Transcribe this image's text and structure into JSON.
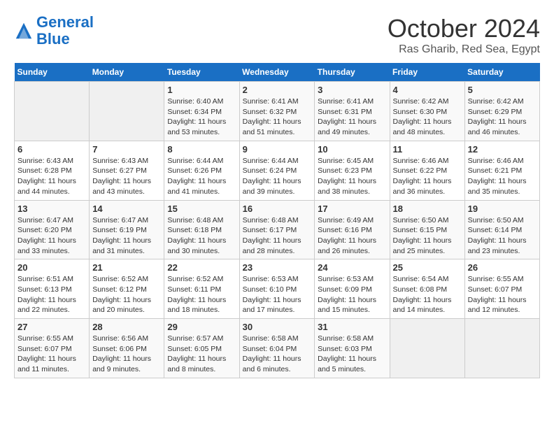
{
  "header": {
    "logo_line1": "General",
    "logo_line2": "Blue",
    "month": "October 2024",
    "location": "Ras Gharib, Red Sea, Egypt"
  },
  "weekdays": [
    "Sunday",
    "Monday",
    "Tuesday",
    "Wednesday",
    "Thursday",
    "Friday",
    "Saturday"
  ],
  "weeks": [
    [
      {
        "day": "",
        "info": ""
      },
      {
        "day": "",
        "info": ""
      },
      {
        "day": "1",
        "info": "Sunrise: 6:40 AM\nSunset: 6:34 PM\nDaylight: 11 hours and 53 minutes."
      },
      {
        "day": "2",
        "info": "Sunrise: 6:41 AM\nSunset: 6:32 PM\nDaylight: 11 hours and 51 minutes."
      },
      {
        "day": "3",
        "info": "Sunrise: 6:41 AM\nSunset: 6:31 PM\nDaylight: 11 hours and 49 minutes."
      },
      {
        "day": "4",
        "info": "Sunrise: 6:42 AM\nSunset: 6:30 PM\nDaylight: 11 hours and 48 minutes."
      },
      {
        "day": "5",
        "info": "Sunrise: 6:42 AM\nSunset: 6:29 PM\nDaylight: 11 hours and 46 minutes."
      }
    ],
    [
      {
        "day": "6",
        "info": "Sunrise: 6:43 AM\nSunset: 6:28 PM\nDaylight: 11 hours and 44 minutes."
      },
      {
        "day": "7",
        "info": "Sunrise: 6:43 AM\nSunset: 6:27 PM\nDaylight: 11 hours and 43 minutes."
      },
      {
        "day": "8",
        "info": "Sunrise: 6:44 AM\nSunset: 6:26 PM\nDaylight: 11 hours and 41 minutes."
      },
      {
        "day": "9",
        "info": "Sunrise: 6:44 AM\nSunset: 6:24 PM\nDaylight: 11 hours and 39 minutes."
      },
      {
        "day": "10",
        "info": "Sunrise: 6:45 AM\nSunset: 6:23 PM\nDaylight: 11 hours and 38 minutes."
      },
      {
        "day": "11",
        "info": "Sunrise: 6:46 AM\nSunset: 6:22 PM\nDaylight: 11 hours and 36 minutes."
      },
      {
        "day": "12",
        "info": "Sunrise: 6:46 AM\nSunset: 6:21 PM\nDaylight: 11 hours and 35 minutes."
      }
    ],
    [
      {
        "day": "13",
        "info": "Sunrise: 6:47 AM\nSunset: 6:20 PM\nDaylight: 11 hours and 33 minutes."
      },
      {
        "day": "14",
        "info": "Sunrise: 6:47 AM\nSunset: 6:19 PM\nDaylight: 11 hours and 31 minutes."
      },
      {
        "day": "15",
        "info": "Sunrise: 6:48 AM\nSunset: 6:18 PM\nDaylight: 11 hours and 30 minutes."
      },
      {
        "day": "16",
        "info": "Sunrise: 6:48 AM\nSunset: 6:17 PM\nDaylight: 11 hours and 28 minutes."
      },
      {
        "day": "17",
        "info": "Sunrise: 6:49 AM\nSunset: 6:16 PM\nDaylight: 11 hours and 26 minutes."
      },
      {
        "day": "18",
        "info": "Sunrise: 6:50 AM\nSunset: 6:15 PM\nDaylight: 11 hours and 25 minutes."
      },
      {
        "day": "19",
        "info": "Sunrise: 6:50 AM\nSunset: 6:14 PM\nDaylight: 11 hours and 23 minutes."
      }
    ],
    [
      {
        "day": "20",
        "info": "Sunrise: 6:51 AM\nSunset: 6:13 PM\nDaylight: 11 hours and 22 minutes."
      },
      {
        "day": "21",
        "info": "Sunrise: 6:52 AM\nSunset: 6:12 PM\nDaylight: 11 hours and 20 minutes."
      },
      {
        "day": "22",
        "info": "Sunrise: 6:52 AM\nSunset: 6:11 PM\nDaylight: 11 hours and 18 minutes."
      },
      {
        "day": "23",
        "info": "Sunrise: 6:53 AM\nSunset: 6:10 PM\nDaylight: 11 hours and 17 minutes."
      },
      {
        "day": "24",
        "info": "Sunrise: 6:53 AM\nSunset: 6:09 PM\nDaylight: 11 hours and 15 minutes."
      },
      {
        "day": "25",
        "info": "Sunrise: 6:54 AM\nSunset: 6:08 PM\nDaylight: 11 hours and 14 minutes."
      },
      {
        "day": "26",
        "info": "Sunrise: 6:55 AM\nSunset: 6:07 PM\nDaylight: 11 hours and 12 minutes."
      }
    ],
    [
      {
        "day": "27",
        "info": "Sunrise: 6:55 AM\nSunset: 6:07 PM\nDaylight: 11 hours and 11 minutes."
      },
      {
        "day": "28",
        "info": "Sunrise: 6:56 AM\nSunset: 6:06 PM\nDaylight: 11 hours and 9 minutes."
      },
      {
        "day": "29",
        "info": "Sunrise: 6:57 AM\nSunset: 6:05 PM\nDaylight: 11 hours and 8 minutes."
      },
      {
        "day": "30",
        "info": "Sunrise: 6:58 AM\nSunset: 6:04 PM\nDaylight: 11 hours and 6 minutes."
      },
      {
        "day": "31",
        "info": "Sunrise: 6:58 AM\nSunset: 6:03 PM\nDaylight: 11 hours and 5 minutes."
      },
      {
        "day": "",
        "info": ""
      },
      {
        "day": "",
        "info": ""
      }
    ]
  ]
}
